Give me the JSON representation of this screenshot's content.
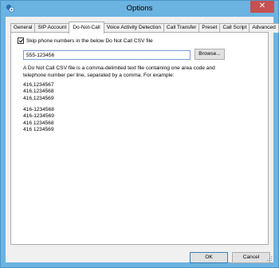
{
  "window": {
    "title": "Options",
    "close_label": "✕"
  },
  "tabs": [
    {
      "label": "General"
    },
    {
      "label": "SIP Account"
    },
    {
      "label": "Do-Not-Call",
      "active": true
    },
    {
      "label": "Voice Activity Detection"
    },
    {
      "label": "Call Transfer"
    },
    {
      "label": "Preset"
    },
    {
      "label": "Call Script"
    },
    {
      "label": "Advanced"
    }
  ],
  "dnc": {
    "skip_label": "Skip phone numbers in the below Do Not Call CSV file",
    "skip_checked": true,
    "file_value": "555-123456",
    "browse_label": "Browse...",
    "description_1": "A Do Not Call CSV file is a comma-delimited text file containing one area code and",
    "description_2": "telephone number per line, separated by a comma. For example:",
    "example_1": [
      "416,1234567",
      "416,1234568",
      "416,1234569"
    ],
    "example_2": [
      "416-1234568",
      "416-1234569",
      "416 1234568",
      "416 1234569"
    ]
  },
  "footer": {
    "ok_label": "OK",
    "cancel_label": "Cancel"
  }
}
